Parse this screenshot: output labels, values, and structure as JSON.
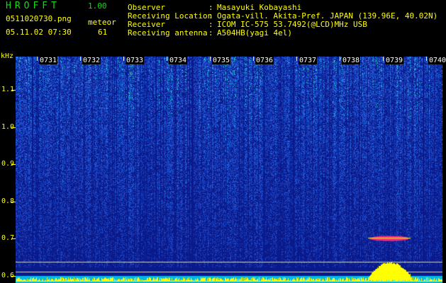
{
  "app": {
    "title": "HROFFT",
    "version": "1.00",
    "filename": "0511020730.png",
    "mode": "meteor",
    "datetime": "05.11.02 07:30",
    "count": "61"
  },
  "info": [
    {
      "label": "Observer",
      "value": "Masayuki Kobayashi"
    },
    {
      "label": "Receiving Location",
      "value": "Ogata-vill. Akita-Pref. JAPAN (139.96E, 40.02N)"
    },
    {
      "label": "Receiver",
      "value": "ICOM IC-575 53.7492(@LCD)MHz USB"
    },
    {
      "label": "Receiving antenna",
      "value": "A504HB(yagi 4el)"
    }
  ],
  "colon": ":",
  "axis": {
    "y_unit": "kHz",
    "y_ticks": [
      "1.1",
      "1.0",
      "0.9",
      "0.8",
      "0.7",
      "0.6"
    ],
    "y_range": [
      0.58,
      1.19
    ],
    "x_ticks": [
      "0731",
      "0732",
      "0733",
      "0734",
      "0735",
      "0736",
      "0737",
      "0738",
      "0739",
      "0740"
    ]
  },
  "colors": {
    "background": "#000000",
    "header_text": "#ffff00",
    "title_text": "#18d818",
    "tick_text": "#ffffff",
    "spectrum_base": "#0a1a8a",
    "spectrum_noise": "#1e4ee0",
    "spectrum_bright": "#29d8d0",
    "meteor_echo": "#ff2e7a",
    "level_trace": "#ffff00",
    "ref_line": "#d0d0d0"
  },
  "meteor_echo": {
    "time": "0739",
    "freq_khz": 0.7
  }
}
